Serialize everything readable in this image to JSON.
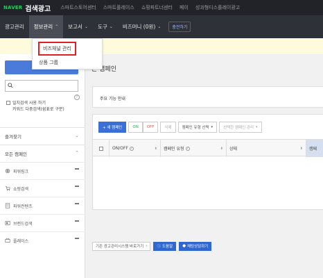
{
  "topbar": {
    "brand": "NAVER",
    "title": "검색광고",
    "links": [
      "스마트스토어센터",
      "스마트플레이스",
      "쇼핑파트너센터",
      "페이",
      "성과형디스플레이광고"
    ]
  },
  "menubar": {
    "items": [
      {
        "label": "광고관리",
        "chevron": false
      },
      {
        "label": "정보관리",
        "chevron": true,
        "active": true
      },
      {
        "label": "보고서",
        "chevron": true
      },
      {
        "label": "도구",
        "chevron": true
      },
      {
        "label": "비즈머니 (0원)",
        "chevron": true
      }
    ],
    "charge_label": "충전하기"
  },
  "dropdown": {
    "items": [
      "비즈채널 관리",
      "상품 그룹"
    ]
  },
  "sidebar": {
    "search_icon": "search-icon",
    "check_label": "일치검색 사용 하기",
    "check_sub": "키워드 다중검색(쉼표로 구분)",
    "help": "?",
    "favorites_label": "즐겨찾기",
    "all_campaigns_label": "모든 캠페인",
    "campaign_types": [
      {
        "label": "파워링크",
        "icon": "globe-icon"
      },
      {
        "label": "쇼핑검색",
        "icon": "cart-icon"
      },
      {
        "label": "파워컨텐츠",
        "icon": "document-icon"
      },
      {
        "label": "브랜드검색",
        "icon": "brand-icon"
      },
      {
        "label": "플레이스",
        "icon": "place-icon"
      }
    ],
    "colors": {
      "create_button": "#4a7bdb"
    }
  },
  "main": {
    "title_partial": "든 캠페인",
    "panel1_label": "주요 기능 안내",
    "toolbar": {
      "new_campaign": "+ 새 캠페인",
      "on": "ON",
      "off": "OFF",
      "delete": "삭제",
      "change_type": "캠페인 유형 선택",
      "selected_manage": "선택한 캠페인 관리"
    },
    "table_headers": [
      "ON/OFF",
      "캠페인 유형",
      "상태",
      "캠페"
    ],
    "bottom": {
      "legacy": "기존 광고관리시스템 바로가기",
      "help": "도움말",
      "chat": "채팅상담하기"
    }
  }
}
